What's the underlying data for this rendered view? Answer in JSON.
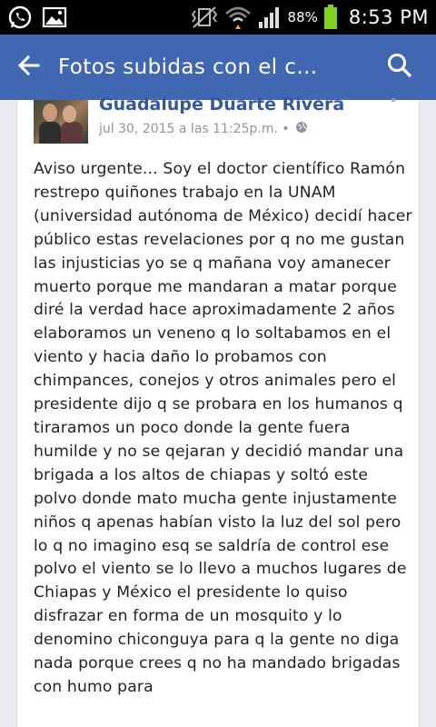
{
  "status_bar": {
    "battery_percent": "88%",
    "time": "8:53 PM",
    "icons": [
      "whatsapp-icon",
      "gallery-icon",
      "vibrate-mute-icon",
      "wifi-icon",
      "signal-icon",
      "battery-icon"
    ]
  },
  "app_bar": {
    "title": "Fotos subidas con el c…",
    "back_icon": "arrow-back-icon",
    "search_icon": "search-icon"
  },
  "post": {
    "author": "Guadalupe Duarte Rivera",
    "timestamp": "jul 30, 2015 a las 11:25p.m. •",
    "privacy_icon": "globe-icon",
    "text": "Aviso urgente... Soy el doctor científico Ramón restrepo quiñones trabajo en la UNAM (universidad autónoma de México) decidí hacer público estas revelaciones por q no me gustan las injusticias yo se q mañana voy amanecer muerto porque me mandaran a matar porque diré la verdad hace aproximadamente  2 años elaboramos un veneno q lo soltabamos en el viento y hacia daño lo probamos con chimpances, conejos y otros animales pero el presidente dijo q se probara en los humanos q tiraramos un poco donde la gente fuera humilde y no se qejaran y decidió mandar una brigada a los altos de chiapas y soltó este polvo donde mato mucha gente injustamente niños q apenas habían visto la luz del sol pero lo q no imagino esq se saldría de control ese polvo el viento se lo llevo a muchos lugares de Chiapas y México el presidente lo quiso disfrazar en forma de un mosquito y lo denomino chiconguya para q la gente no diga nada porque crees q no ha mandado brigadas con humo para"
  },
  "colors": {
    "app_bar": "#4267b2",
    "author": "#365899",
    "meta": "#90949c",
    "battery": "#7ed321"
  }
}
